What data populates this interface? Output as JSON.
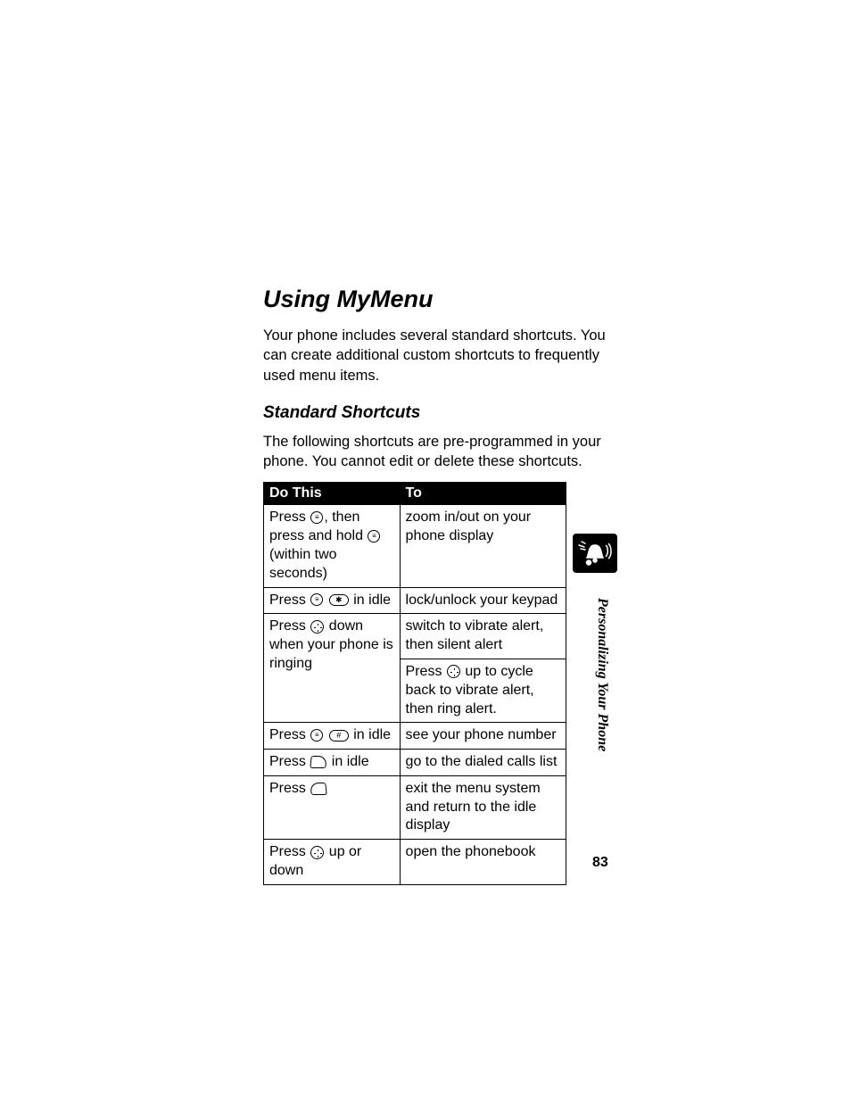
{
  "heading": "Using MyMenu",
  "intro": "Your phone includes several standard shortcuts. You can create additional custom shortcuts to frequently used menu items.",
  "subheading": "Standard Shortcuts",
  "subintro": "The following shortcuts are pre-programmed in your phone. You cannot edit or delete these shortcuts.",
  "table": {
    "headers": {
      "do": "Do This",
      "to": "To"
    },
    "rows": [
      {
        "do_parts": [
          "Press ",
          {
            "key": "menu"
          },
          ", then press and hold ",
          {
            "key": "menu"
          },
          " (within two seconds)"
        ],
        "to": "zoom in/out on your phone display"
      },
      {
        "do_parts": [
          "Press ",
          {
            "key": "menu"
          },
          " ",
          {
            "key": "star"
          },
          " in idle"
        ],
        "to": "lock/unlock your keypad"
      },
      {
        "do_parts": [
          "Press ",
          {
            "key": "nav"
          },
          " down when your phone is ringing"
        ],
        "to": "switch to vibrate alert, then silent alert",
        "to2_parts": [
          "Press ",
          {
            "key": "nav"
          },
          " up to cycle back to vibrate alert, then ring alert."
        ]
      },
      {
        "do_parts": [
          "Press ",
          {
            "key": "menu"
          },
          " ",
          {
            "key": "hash"
          },
          " in idle"
        ],
        "to": "see your phone number"
      },
      {
        "do_parts": [
          "Press ",
          {
            "key": "send"
          },
          " in idle"
        ],
        "to": "go to the dialed calls list"
      },
      {
        "do_parts": [
          "Press ",
          {
            "key": "end"
          }
        ],
        "to": "exit the menu system and return to the idle display"
      },
      {
        "do_parts": [
          "Press ",
          {
            "key": "nav"
          },
          " up or down"
        ],
        "to": "open the phonebook"
      }
    ]
  },
  "key_glyphs": {
    "menu": "≡",
    "star": "✱",
    "hash": "#",
    "send": "↗",
    "end": "↘"
  },
  "side_label": "Personalizing Your Phone",
  "page_number": "83"
}
